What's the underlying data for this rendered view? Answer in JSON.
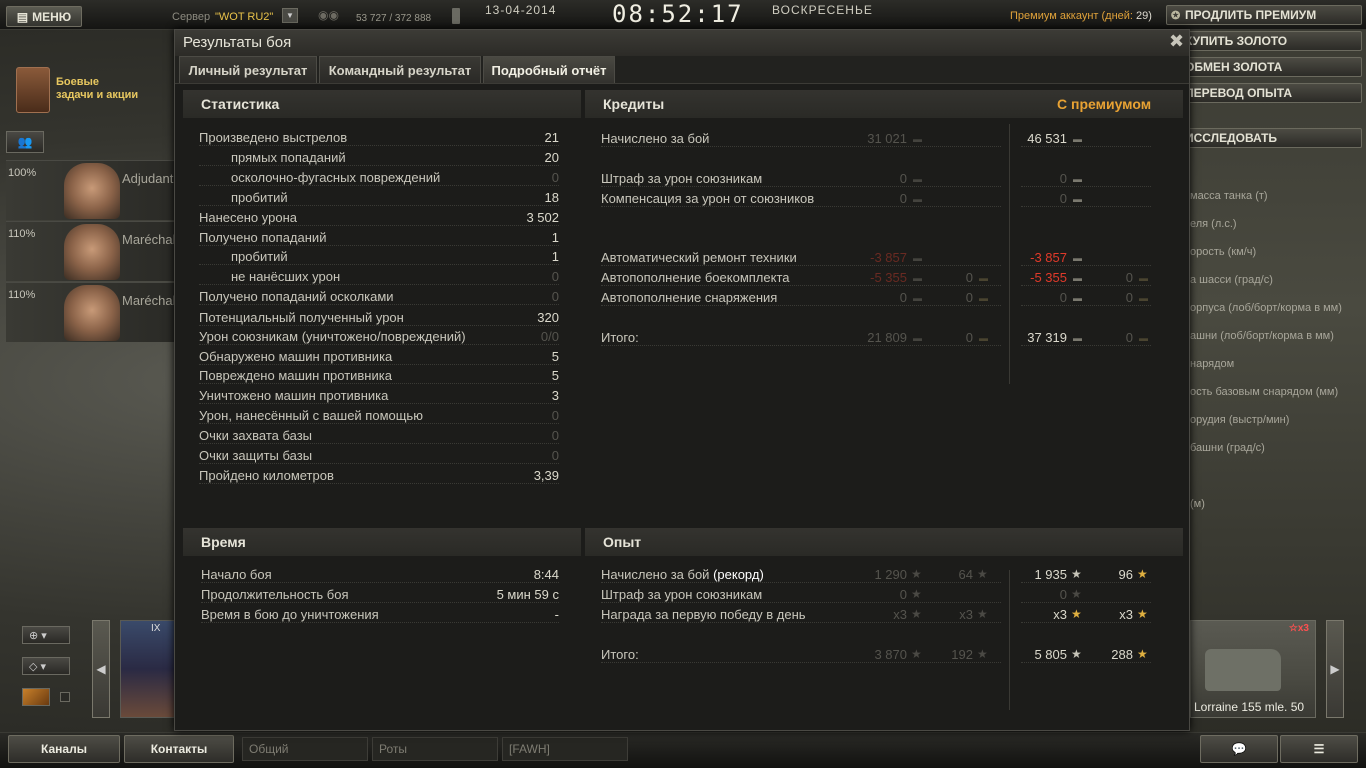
{
  "topbar": {
    "menu_label": "МЕНЮ",
    "server_label": "Сервер",
    "server_name": "\"WOT RU2\"",
    "online": "53 727 / 372 888",
    "date": "13-04-2014",
    "time": "08:52:17",
    "weekday": "ВОСКРЕСЕНЬЕ",
    "premium_text": "Премиум аккаунт (дней:",
    "premium_days": "29)"
  },
  "side_buttons": [
    "ПРОДЛИТЬ ПРЕМИУМ",
    "КУПИТЬ ЗОЛОТО",
    "ОБМЕН ЗОЛОТА",
    "ПЕРЕВОД ОПЫТА",
    "ИССЛЕДОВАТЬ"
  ],
  "tank_props": [
    "масса танка (т)",
    "еля (л.с.)",
    "орость (км/ч)",
    "а шасси (град/с)",
    "орпуса (лоб/борт/корма в мм)",
    "ашни (лоб/борт/корма в мм)",
    "нарядом",
    "ость базовым снарядом (мм)",
    "орудия (выстр/мин)",
    "башни (град/с)",
    "(м)"
  ],
  "missions_label": [
    "Боевые",
    "задачи и акции"
  ],
  "crew": [
    {
      "pct": "100%",
      "name": "Adjudant"
    },
    {
      "pct": "110%",
      "name": "Maréchal"
    },
    {
      "pct": "110%",
      "name": "Maréchal"
    }
  ],
  "carousel": {
    "left_tier": "IX",
    "right_tank_name": "Lorraine 155 mle. 50",
    "right_badge": "x3"
  },
  "bottombar": {
    "channels_btn": "Каналы",
    "contacts_btn": "Контакты",
    "channel_1": "Общий",
    "channel_2": "Роты",
    "channel_3": "[FAWH]"
  },
  "window": {
    "title": "Результаты боя",
    "tabs": [
      "Личный результат",
      "Командный результат",
      "Подробный отчёт"
    ]
  },
  "stats": {
    "header": "Статистика",
    "rows": [
      {
        "label": "Произведено выстрелов",
        "value": "21",
        "indent": false,
        "dim": false
      },
      {
        "label": "прямых попаданий",
        "value": "20",
        "indent": true,
        "dim": false
      },
      {
        "label": "осколочно-фугасных повреждений",
        "value": "0",
        "indent": true,
        "dim": true
      },
      {
        "label": "пробитий",
        "value": "18",
        "indent": true,
        "dim": false
      },
      {
        "label": "Нанесено урона",
        "value": "3 502",
        "indent": false,
        "dim": false
      },
      {
        "label": "Получено попаданий",
        "value": "1",
        "indent": false,
        "dim": false
      },
      {
        "label": "пробитий",
        "value": "1",
        "indent": true,
        "dim": false
      },
      {
        "label": "не нанёсших урон",
        "value": "0",
        "indent": true,
        "dim": true
      },
      {
        "label": "Получено попаданий осколками",
        "value": "0",
        "indent": false,
        "dim": true
      },
      {
        "label": "Потенциальный полученный урон",
        "value": "320",
        "indent": false,
        "dim": false
      },
      {
        "label": "Урон союзникам (уничтожено/повреждений)",
        "value": "0/0",
        "indent": false,
        "dim": true
      },
      {
        "label": "Обнаружено машин противника",
        "value": "5",
        "indent": false,
        "dim": false
      },
      {
        "label": "Повреждено машин противника",
        "value": "5",
        "indent": false,
        "dim": false
      },
      {
        "label": "Уничтожено машин противника",
        "value": "3",
        "indent": false,
        "dim": false
      },
      {
        "label": "Урон, нанесённый с вашей помощью",
        "value": "0",
        "indent": false,
        "dim": true
      },
      {
        "label": "Очки захвата базы",
        "value": "0",
        "indent": false,
        "dim": true
      },
      {
        "label": "Очки защиты базы",
        "value": "0",
        "indent": false,
        "dim": true
      },
      {
        "label": "Пройдено километров",
        "value": "3,39",
        "indent": false,
        "dim": false
      }
    ]
  },
  "credits": {
    "header": "Кредиты",
    "premium_header": "С премиумом",
    "rows": [
      {
        "label": "Начислено за бой",
        "base": "31 021",
        "base_gold": "",
        "prem": "46 531",
        "prem_gold": "",
        "style": "normal"
      },
      {
        "label": "Штраф за урон союзникам",
        "base": "0",
        "base_gold": "",
        "prem": "0",
        "prem_gold": "",
        "style": "dim"
      },
      {
        "label": "Компенсация за урон от союзников",
        "base": "0",
        "base_gold": "",
        "prem": "0",
        "prem_gold": "",
        "style": "dim"
      },
      {
        "label": "Автоматический ремонт техники",
        "base": "-3 857",
        "base_gold": "",
        "prem": "-3 857",
        "prem_gold": "",
        "style": "red"
      },
      {
        "label": "Автопополнение боекомплекта",
        "base": "-5 355",
        "base_gold": "0",
        "prem": "-5 355",
        "prem_gold": "0",
        "style": "red"
      },
      {
        "label": "Автопополнение снаряжения",
        "base": "0",
        "base_gold": "0",
        "prem": "0",
        "prem_gold": "0",
        "style": "dim"
      },
      {
        "label": "Итого:",
        "base": "21 809",
        "base_gold": "0",
        "prem": "37 319",
        "prem_gold": "0",
        "style": "total"
      }
    ]
  },
  "time": {
    "header": "Время",
    "rows": [
      {
        "label": "Начало боя",
        "value": "8:44"
      },
      {
        "label": "Продолжительность боя",
        "value": "5 мин 59 с"
      },
      {
        "label": "Время в бою до уничтожения",
        "value": "-"
      }
    ]
  },
  "experience": {
    "header": "Опыт",
    "rows": [
      {
        "label": "Начислено за бой",
        "label_extra": "(рекорд)",
        "base": "1 290",
        "base_free": "64",
        "prem": "1 935",
        "prem_free": "96"
      },
      {
        "label": "Штраф за урон союзникам",
        "label_extra": "",
        "base": "0",
        "base_free": "",
        "prem": "0",
        "prem_free": ""
      },
      {
        "label": "Награда за первую победу в день",
        "label_extra": "",
        "base": "x3",
        "base_free": "x3",
        "prem": "x3",
        "prem_free": "x3"
      },
      {
        "label": "Итого:",
        "label_extra": "",
        "base": "3 870",
        "base_free": "192",
        "prem": "5 805",
        "prem_free": "288"
      }
    ]
  }
}
